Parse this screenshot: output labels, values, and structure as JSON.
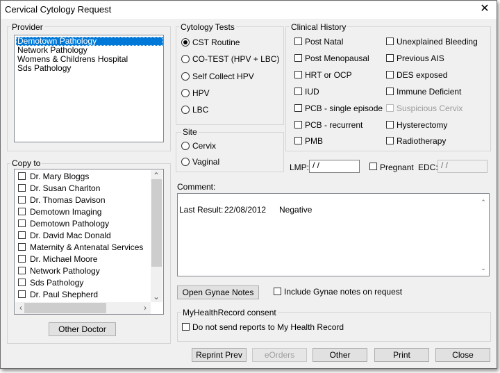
{
  "window": {
    "title": "Cervical Cytology Request"
  },
  "provider": {
    "legend": "Provider",
    "items": [
      "Demotown Pathology",
      "Network Pathology",
      "Womens & Childrens Hospital",
      "Sds Pathology"
    ],
    "selected_index": 0
  },
  "copy_to": {
    "legend": "Copy to",
    "items": [
      "Dr. Mary Bloggs",
      "Dr. Susan Charlton",
      "Dr. Thomas Davison",
      "Demotown Imaging",
      "Demotown Pathology",
      "Dr. David Mac Donald",
      "Maternity & Antenatal Services",
      "Dr. Michael Moore",
      "Network Pathology",
      "Sds Pathology",
      "Dr. Paul Shepherd"
    ],
    "other_doctor_label": "Other Doctor"
  },
  "cytology_tests": {
    "legend": "Cytology Tests",
    "options": [
      "CST Routine",
      "CO-TEST (HPV + LBC)",
      "Self Collect HPV",
      "HPV",
      "LBC"
    ],
    "selected_index": 0
  },
  "site": {
    "legend": "Site",
    "options": [
      "Cervix",
      "Vaginal"
    ]
  },
  "clinical_history": {
    "legend": "Clinical History",
    "left": [
      "Post Natal",
      "Post Menopausal",
      "HRT or OCP",
      "IUD",
      "PCB - single episode",
      "PCB - recurrent",
      "PMB"
    ],
    "right": [
      "Unexplained Bleeding",
      "Previous AIS",
      "DES exposed",
      "Immune Deficient",
      "Suspicious Cervix",
      "Hysterectomy",
      "Radiotherapy"
    ]
  },
  "lmp": {
    "label": "LMP:",
    "value": " /  /"
  },
  "pregnant": {
    "label": "Pregnant"
  },
  "edc": {
    "label": "EDC:",
    "value": " /  /"
  },
  "comment": {
    "label": "Comment:",
    "last_result_label": "Last Result:",
    "last_result_date": "22/08/2012",
    "last_result_value": "Negative"
  },
  "gynae": {
    "open_label": "Open Gynae Notes",
    "include_label": "Include Gynae notes on request"
  },
  "mhr": {
    "legend": "MyHealthRecord consent",
    "label": "Do not send reports to My Health Record"
  },
  "buttons": {
    "reprint": "Reprint Prev",
    "eorders": "eOrders",
    "other": "Other",
    "print": "Print",
    "close": "Close"
  }
}
